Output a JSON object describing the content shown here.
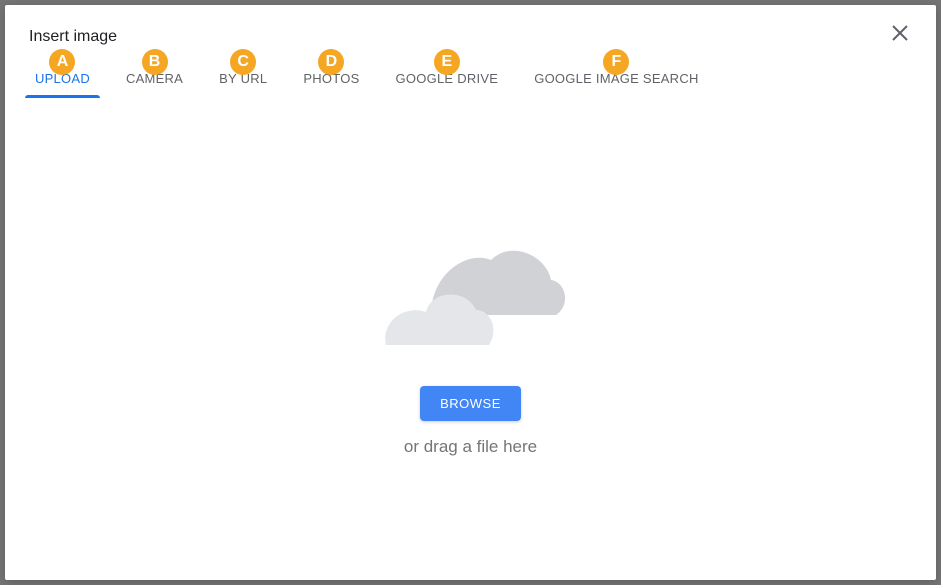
{
  "dialog": {
    "title": "Insert image"
  },
  "tabs": [
    {
      "label": "UPLOAD",
      "badge": "A",
      "active": true
    },
    {
      "label": "CAMERA",
      "badge": "B",
      "active": false
    },
    {
      "label": "BY URL",
      "badge": "C",
      "active": false
    },
    {
      "label": "PHOTOS",
      "badge": "D",
      "active": false
    },
    {
      "label": "GOOGLE DRIVE",
      "badge": "E",
      "active": false
    },
    {
      "label": "GOOGLE IMAGE SEARCH",
      "badge": "F",
      "active": false
    }
  ],
  "upload": {
    "browse_label": "BROWSE",
    "drag_text": "or drag a file here"
  }
}
